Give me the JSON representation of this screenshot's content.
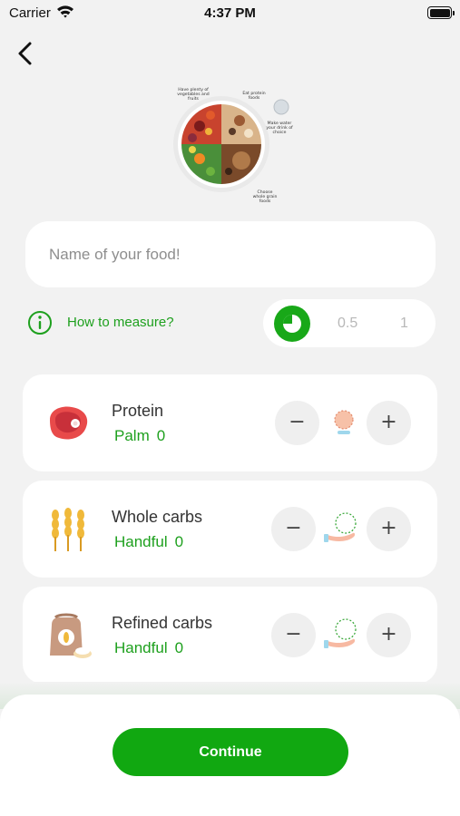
{
  "status_bar": {
    "carrier": "Carrier",
    "time": "4:37 PM"
  },
  "plate": {
    "notes": {
      "top_left": "Have plenty of vegetables and fruits",
      "top_right": "Eat protein foods",
      "right": "Make water your drink of choice",
      "bottom_right": "Choose whole grain foods"
    }
  },
  "food_name": {
    "value": "",
    "placeholder": "Name of your food!"
  },
  "measure": {
    "link_label": "How to measure?",
    "options": [
      "0.5",
      "1"
    ],
    "selected_fraction": 0.25
  },
  "nutrients": [
    {
      "title": "Protein",
      "unit": "Palm",
      "value": "0",
      "icon": "steak-icon",
      "hand_icon": "palm-icon"
    },
    {
      "title": "Whole carbs",
      "unit": "Handful",
      "value": "0",
      "icon": "wheat-icon",
      "hand_icon": "handful-icon"
    },
    {
      "title": "Refined carbs",
      "unit": "Handful",
      "value": "0",
      "icon": "flour-sack-icon",
      "hand_icon": "handful-icon"
    }
  ],
  "buttons": {
    "decrement": "−",
    "increment": "+",
    "continue": "Continue"
  },
  "colors": {
    "accent": "#1ea01e",
    "button_green": "#11a811",
    "card": "#ffffff",
    "background": "#f2f2f2"
  }
}
